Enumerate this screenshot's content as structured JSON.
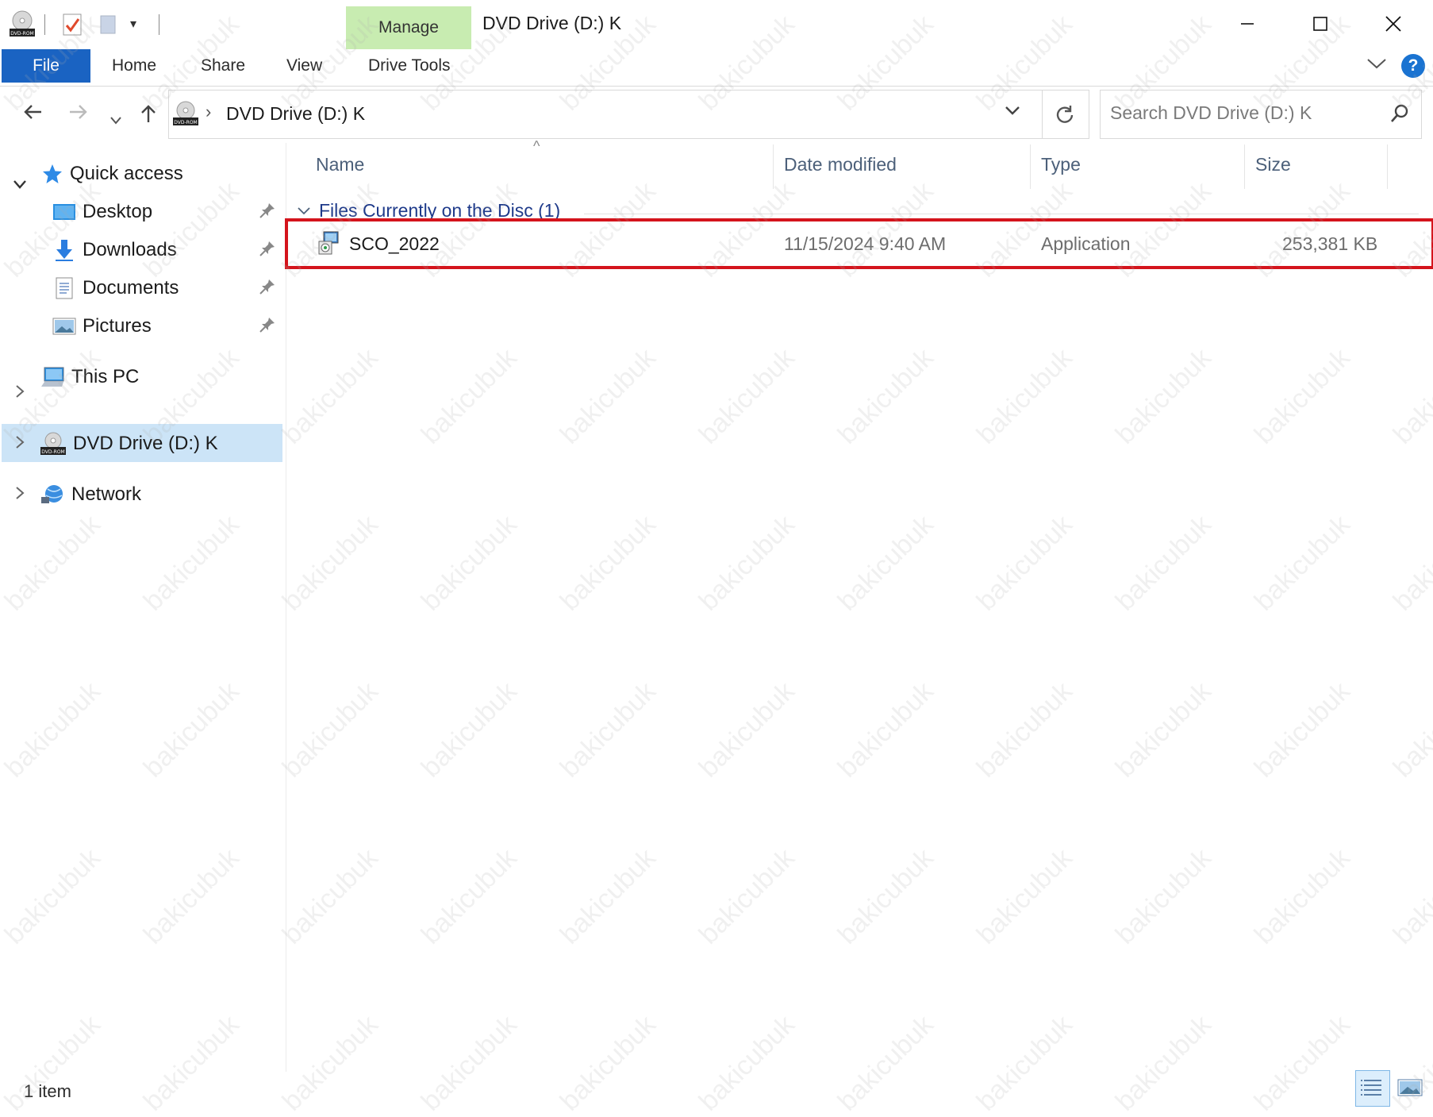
{
  "window": {
    "title": "DVD Drive (D:) K",
    "contextual_tab": "Manage",
    "manage_tab_color": "#c8ecb1"
  },
  "ribbon": {
    "file": "File",
    "tabs": [
      "Home",
      "Share",
      "View",
      "Drive Tools"
    ],
    "file_tab_color": "#1a63c2"
  },
  "address": {
    "path": "DVD Drive (D:) K",
    "search_placeholder": "Search DVD Drive (D:) K"
  },
  "nav": {
    "quick_access": "Quick access",
    "pinned": [
      {
        "label": "Desktop",
        "icon": "desktop-icon"
      },
      {
        "label": "Downloads",
        "icon": "downloads-icon"
      },
      {
        "label": "Documents",
        "icon": "documents-icon"
      },
      {
        "label": "Pictures",
        "icon": "pictures-icon"
      }
    ],
    "this_pc": "This PC",
    "dvd_drive": "DVD Drive (D:) K",
    "network": "Network",
    "dvd_label_small": "DVD-ROM",
    "selection_color": "#cce4f7"
  },
  "columns": {
    "name": "Name",
    "date_modified": "Date modified",
    "type": "Type",
    "size": "Size"
  },
  "group": {
    "title": "Files Currently on the Disc (1)"
  },
  "files": [
    {
      "name": "SCO_2022",
      "date_modified": "11/15/2024 9:40 AM",
      "type": "Application",
      "size": "253,381 KB",
      "icon": "installer-icon"
    }
  ],
  "status": {
    "item_count": "1 item"
  },
  "watermark": "bakicubuk",
  "highlight_color": "#d4141c"
}
